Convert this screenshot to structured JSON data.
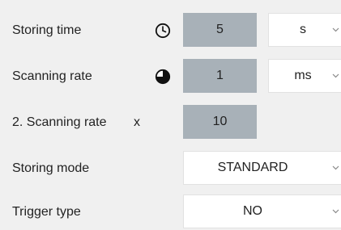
{
  "settings": {
    "storing_time": {
      "label": "Storing time",
      "icon": "clock-icon",
      "value": "5",
      "unit": "s"
    },
    "scanning_rate": {
      "label": "Scanning rate",
      "icon": "timer-icon",
      "value": "1",
      "unit": "ms"
    },
    "second_scanning_rate": {
      "label": "2. Scanning rate",
      "multiplier_symbol": "x",
      "value": "10"
    },
    "storing_mode": {
      "label": "Storing mode",
      "value": "STANDARD"
    },
    "trigger_type": {
      "label": "Trigger type",
      "value": "NO"
    }
  },
  "colors": {
    "background": "#f0f0f0",
    "numeric_field": "#a8b1b8",
    "dropdown": "#ffffff",
    "text": "#222222"
  }
}
